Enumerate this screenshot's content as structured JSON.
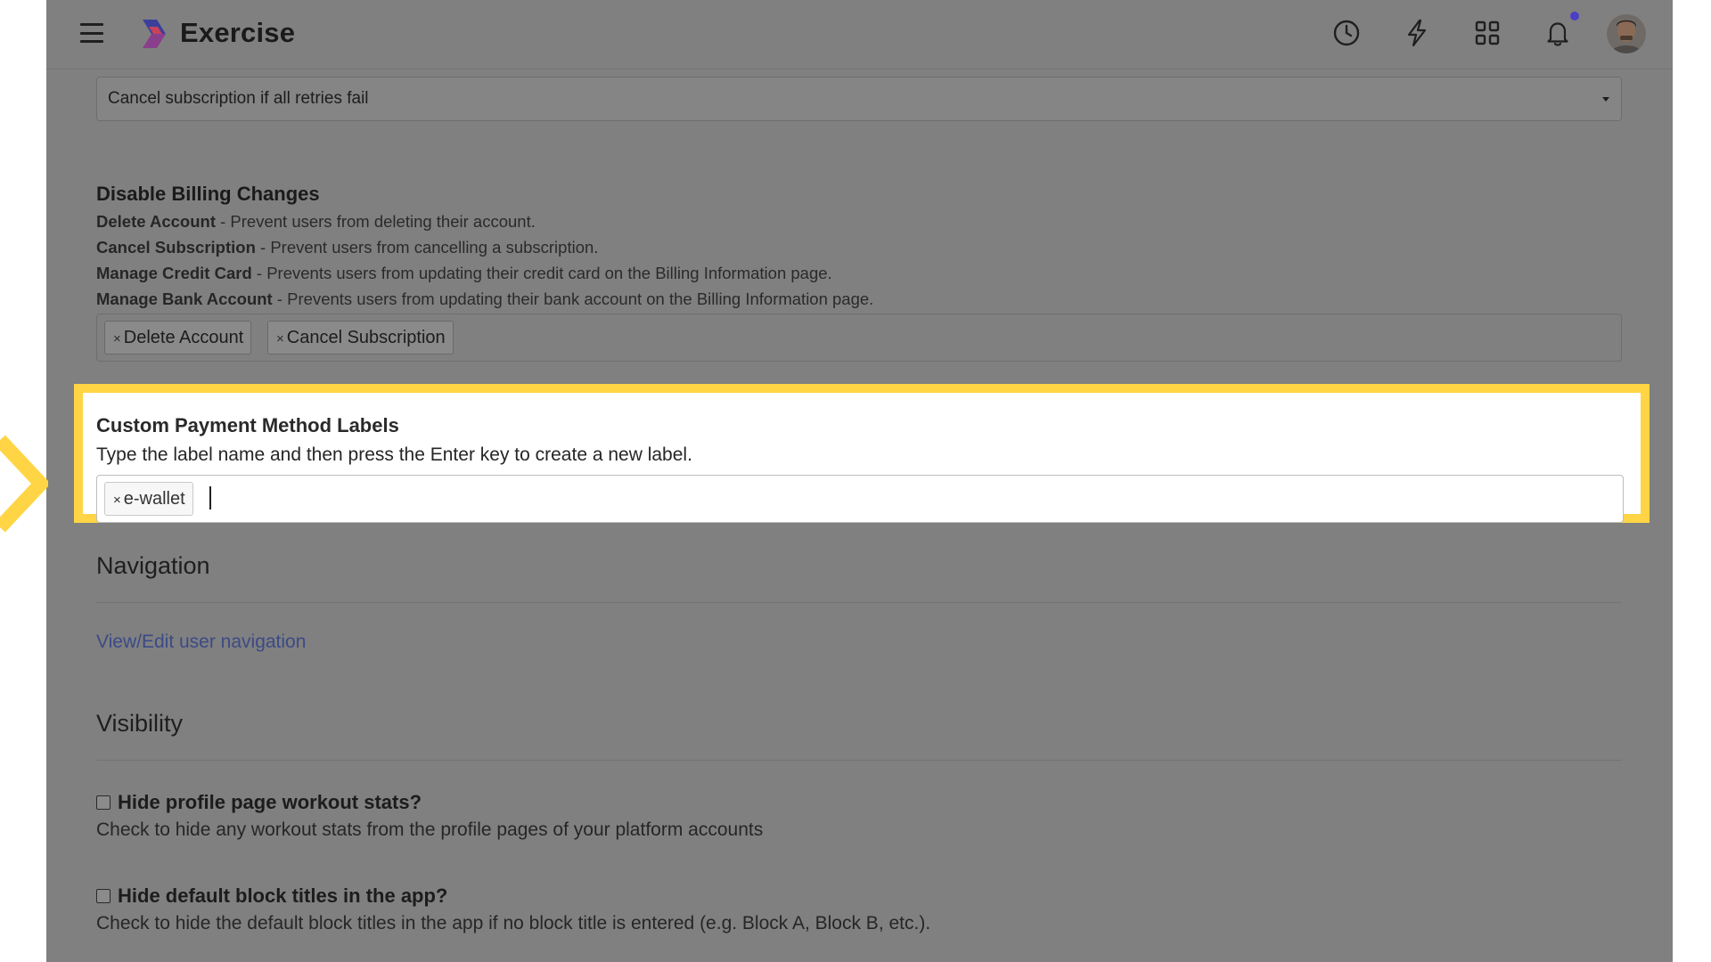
{
  "header": {
    "brand": "Exercise",
    "icons": [
      "history-icon",
      "lightning-icon",
      "apps-grid-icon",
      "bell-icon"
    ]
  },
  "retry_select": {
    "value": "Cancel subscription if all retries fail"
  },
  "billing": {
    "title": "Disable Billing Changes",
    "items": [
      {
        "name": "Delete Account",
        "desc": " - Prevent users from deleting their account."
      },
      {
        "name": "Cancel Subscription",
        "desc": " - Prevent users from cancelling a subscription."
      },
      {
        "name": "Manage Credit Card",
        "desc": " - Prevents users from updating their credit card on the Billing Information page."
      },
      {
        "name": "Manage Bank Account",
        "desc": " - Prevents users from updating their bank account on the Billing Information page."
      }
    ],
    "tags": [
      "Delete Account",
      "Cancel Subscription"
    ]
  },
  "payment_labels": {
    "title": "Custom Payment Method Labels",
    "hint": "Type the label name and then press the Enter key to create a new label.",
    "tags": [
      "e-wallet"
    ]
  },
  "navigation": {
    "heading": "Navigation",
    "link": "View/Edit user navigation"
  },
  "visibility": {
    "heading": "Visibility",
    "options": [
      {
        "label": "Hide profile page workout stats?",
        "desc": "Check to hide any workout stats from the profile pages of your platform accounts",
        "checked": false
      },
      {
        "label": "Hide default block titles in the app?",
        "desc": "Check to hide the default block titles in the app if no block title is entered (e.g. Block A, Block B, etc.).",
        "checked": false
      }
    ]
  },
  "tag_remove_glyph": "×",
  "colors": {
    "highlight": "#ffd545",
    "overlay": "#808080",
    "link": "#3b4a86",
    "notification_dot": "#4b3fc4"
  }
}
